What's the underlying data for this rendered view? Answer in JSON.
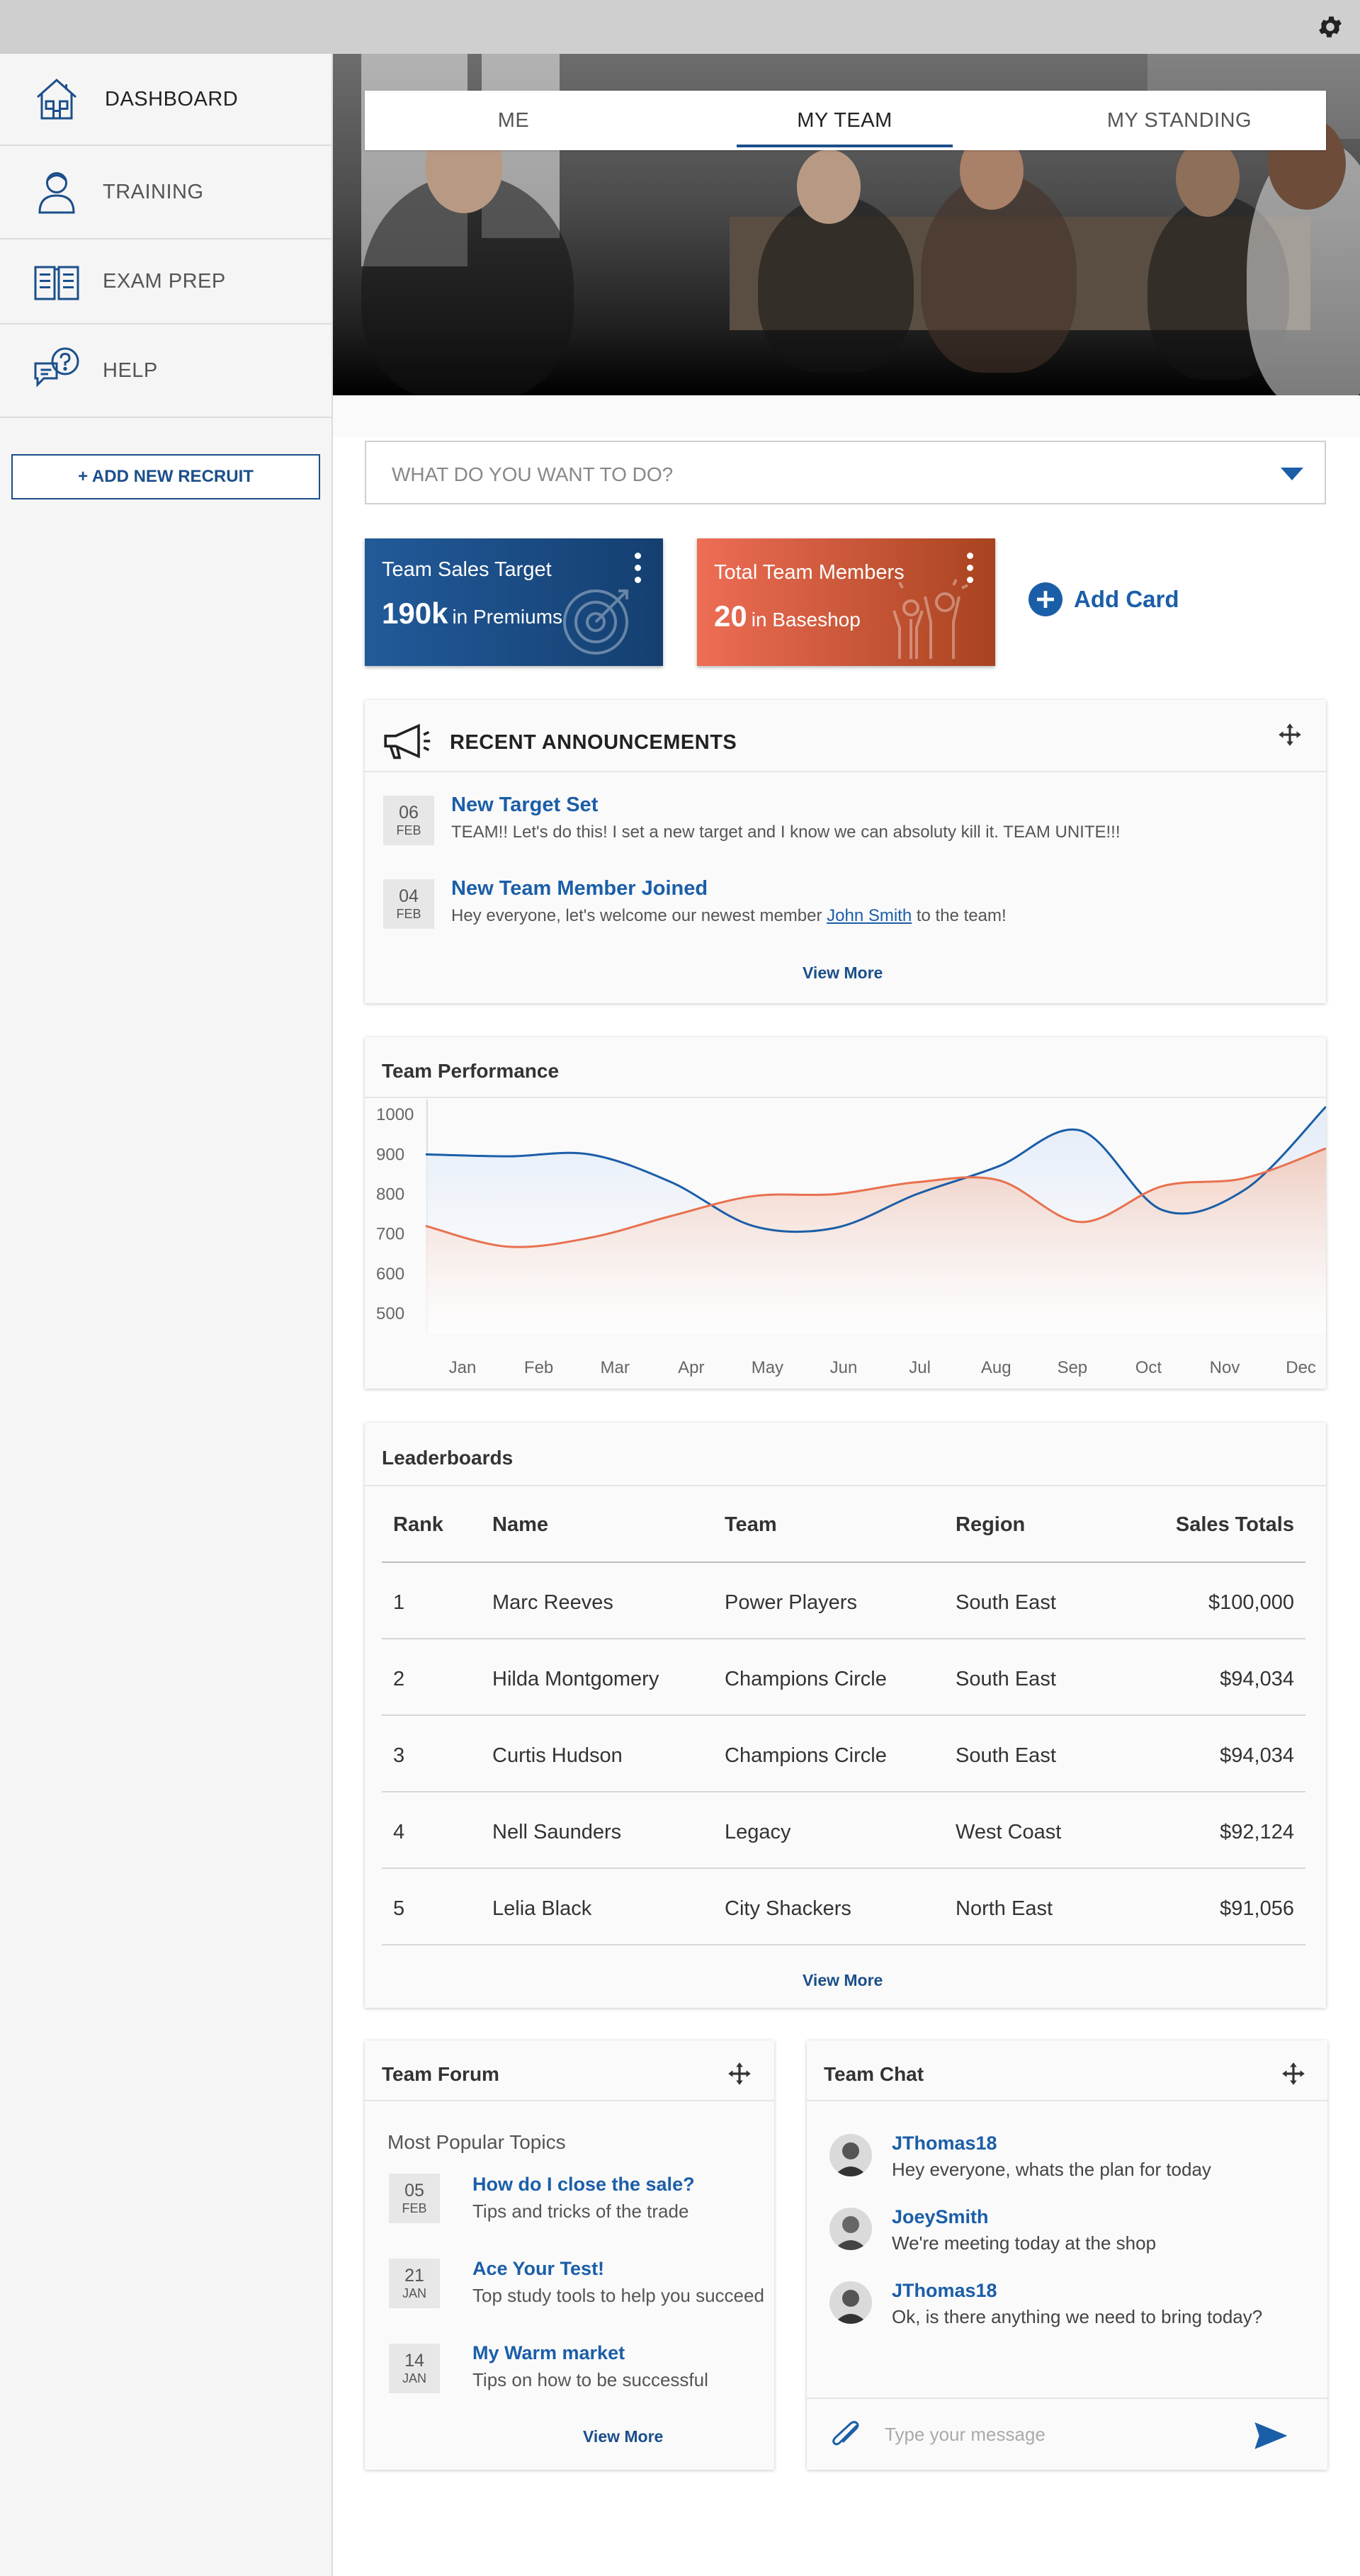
{
  "sidebar": {
    "items": [
      {
        "label": "DASHBOARD",
        "icon": "house-icon"
      },
      {
        "label": "TRAINING",
        "icon": "person-icon"
      },
      {
        "label": "EXAM PREP",
        "icon": "open-book-icon"
      },
      {
        "label": "HELP",
        "icon": "help-chat-icon"
      }
    ],
    "add_recruit": "+ ADD NEW RECRUIT"
  },
  "tabs": [
    {
      "label": "ME"
    },
    {
      "label": "MY TEAM"
    },
    {
      "label": "MY STANDING"
    }
  ],
  "todo": {
    "placeholder": "WHAT DO YOU WANT TO DO?"
  },
  "cards": [
    {
      "title": "Team Sales Target",
      "value": "190k",
      "unit": "in Premiums",
      "color": "#1b4f8a",
      "icon": "target-icon"
    },
    {
      "title": "Total Team Members",
      "value": "20",
      "unit": "in Baseshop",
      "color": "#e0573a",
      "icon": "celebrate-people-icon"
    }
  ],
  "add_card": "Add Card",
  "announcements": {
    "title": "RECENT ANNOUNCEMENTS",
    "items": [
      {
        "day": "06",
        "month": "FEB",
        "title": "New Target Set",
        "text": "TEAM!! Let's do this! I set a new target and I know we can absoluty kill it. TEAM UNITE!!!"
      },
      {
        "day": "04",
        "month": "FEB",
        "title": "New Team Member Joined",
        "text_before": "Hey everyone, let's welcome our newest member",
        "link": "John Smith",
        "text_after": "to the team!"
      }
    ],
    "view_more": "View More"
  },
  "performance": {
    "title": "Team Performance"
  },
  "chart_data": {
    "type": "area",
    "title": "Team Performance",
    "categories": [
      "Jan",
      "Feb",
      "Mar",
      "Apr",
      "May",
      "Jun",
      "Jul",
      "Aug",
      "Sep",
      "Oct",
      "Nov",
      "Dec"
    ],
    "yticks": [
      1000,
      900,
      800,
      700,
      600,
      500
    ],
    "ylim": [
      450,
      1020
    ],
    "series": [
      {
        "values": [
          900,
          895,
          900,
          830,
          720,
          715,
          800,
          870,
          960,
          760,
          810,
          1020
        ],
        "color": "#1b5ea8",
        "fill": "#dfe9f7"
      },
      {
        "values": [
          720,
          668,
          690,
          745,
          795,
          800,
          830,
          835,
          730,
          820,
          840,
          915
        ],
        "color": "#e8714f",
        "fill": "#f0c6b6"
      }
    ],
    "grid": false
  },
  "leaderboard": {
    "title": "Leaderboards",
    "columns": [
      "Rank",
      "Name",
      "Team",
      "Region",
      "Sales Totals"
    ],
    "rows": [
      [
        "1",
        "Marc Reeves",
        "Power Players",
        "South East",
        "$100,000"
      ],
      [
        "2",
        "Hilda Montgomery",
        "Champions Circle",
        "South East",
        "$94,034"
      ],
      [
        "3",
        "Curtis Hudson",
        "Champions Circle",
        "South East",
        "$94,034"
      ],
      [
        "4",
        "Nell Saunders",
        "Legacy",
        "West Coast",
        "$92,124"
      ],
      [
        "5",
        "Lelia Black",
        "City Shackers",
        "North East",
        "$91,056"
      ]
    ],
    "view_more": "View More"
  },
  "forum": {
    "title": "Team Forum",
    "subtitle": "Most Popular Topics",
    "items": [
      {
        "day": "05",
        "month": "FEB",
        "title": "How do I close the sale?",
        "text": "Tips and tricks of the trade"
      },
      {
        "day": "21",
        "month": "JAN",
        "title": "Ace Your Test!",
        "text": "Top study tools to help you succeed"
      },
      {
        "day": "14",
        "month": "JAN",
        "title": "My Warm market",
        "text": "Tips on how to be successful"
      }
    ],
    "view_more": "View More"
  },
  "chat": {
    "title": "Team Chat",
    "messages": [
      {
        "user": "JThomas18",
        "text": "Hey everyone, whats the plan for today"
      },
      {
        "user": "JoeySmith",
        "text": "We're meeting today at the shop"
      },
      {
        "user": "JThomas18",
        "text": "Ok, is there anything we need to bring today?"
      }
    ],
    "placeholder": "Type your message"
  },
  "accent": "#1b4f8a"
}
